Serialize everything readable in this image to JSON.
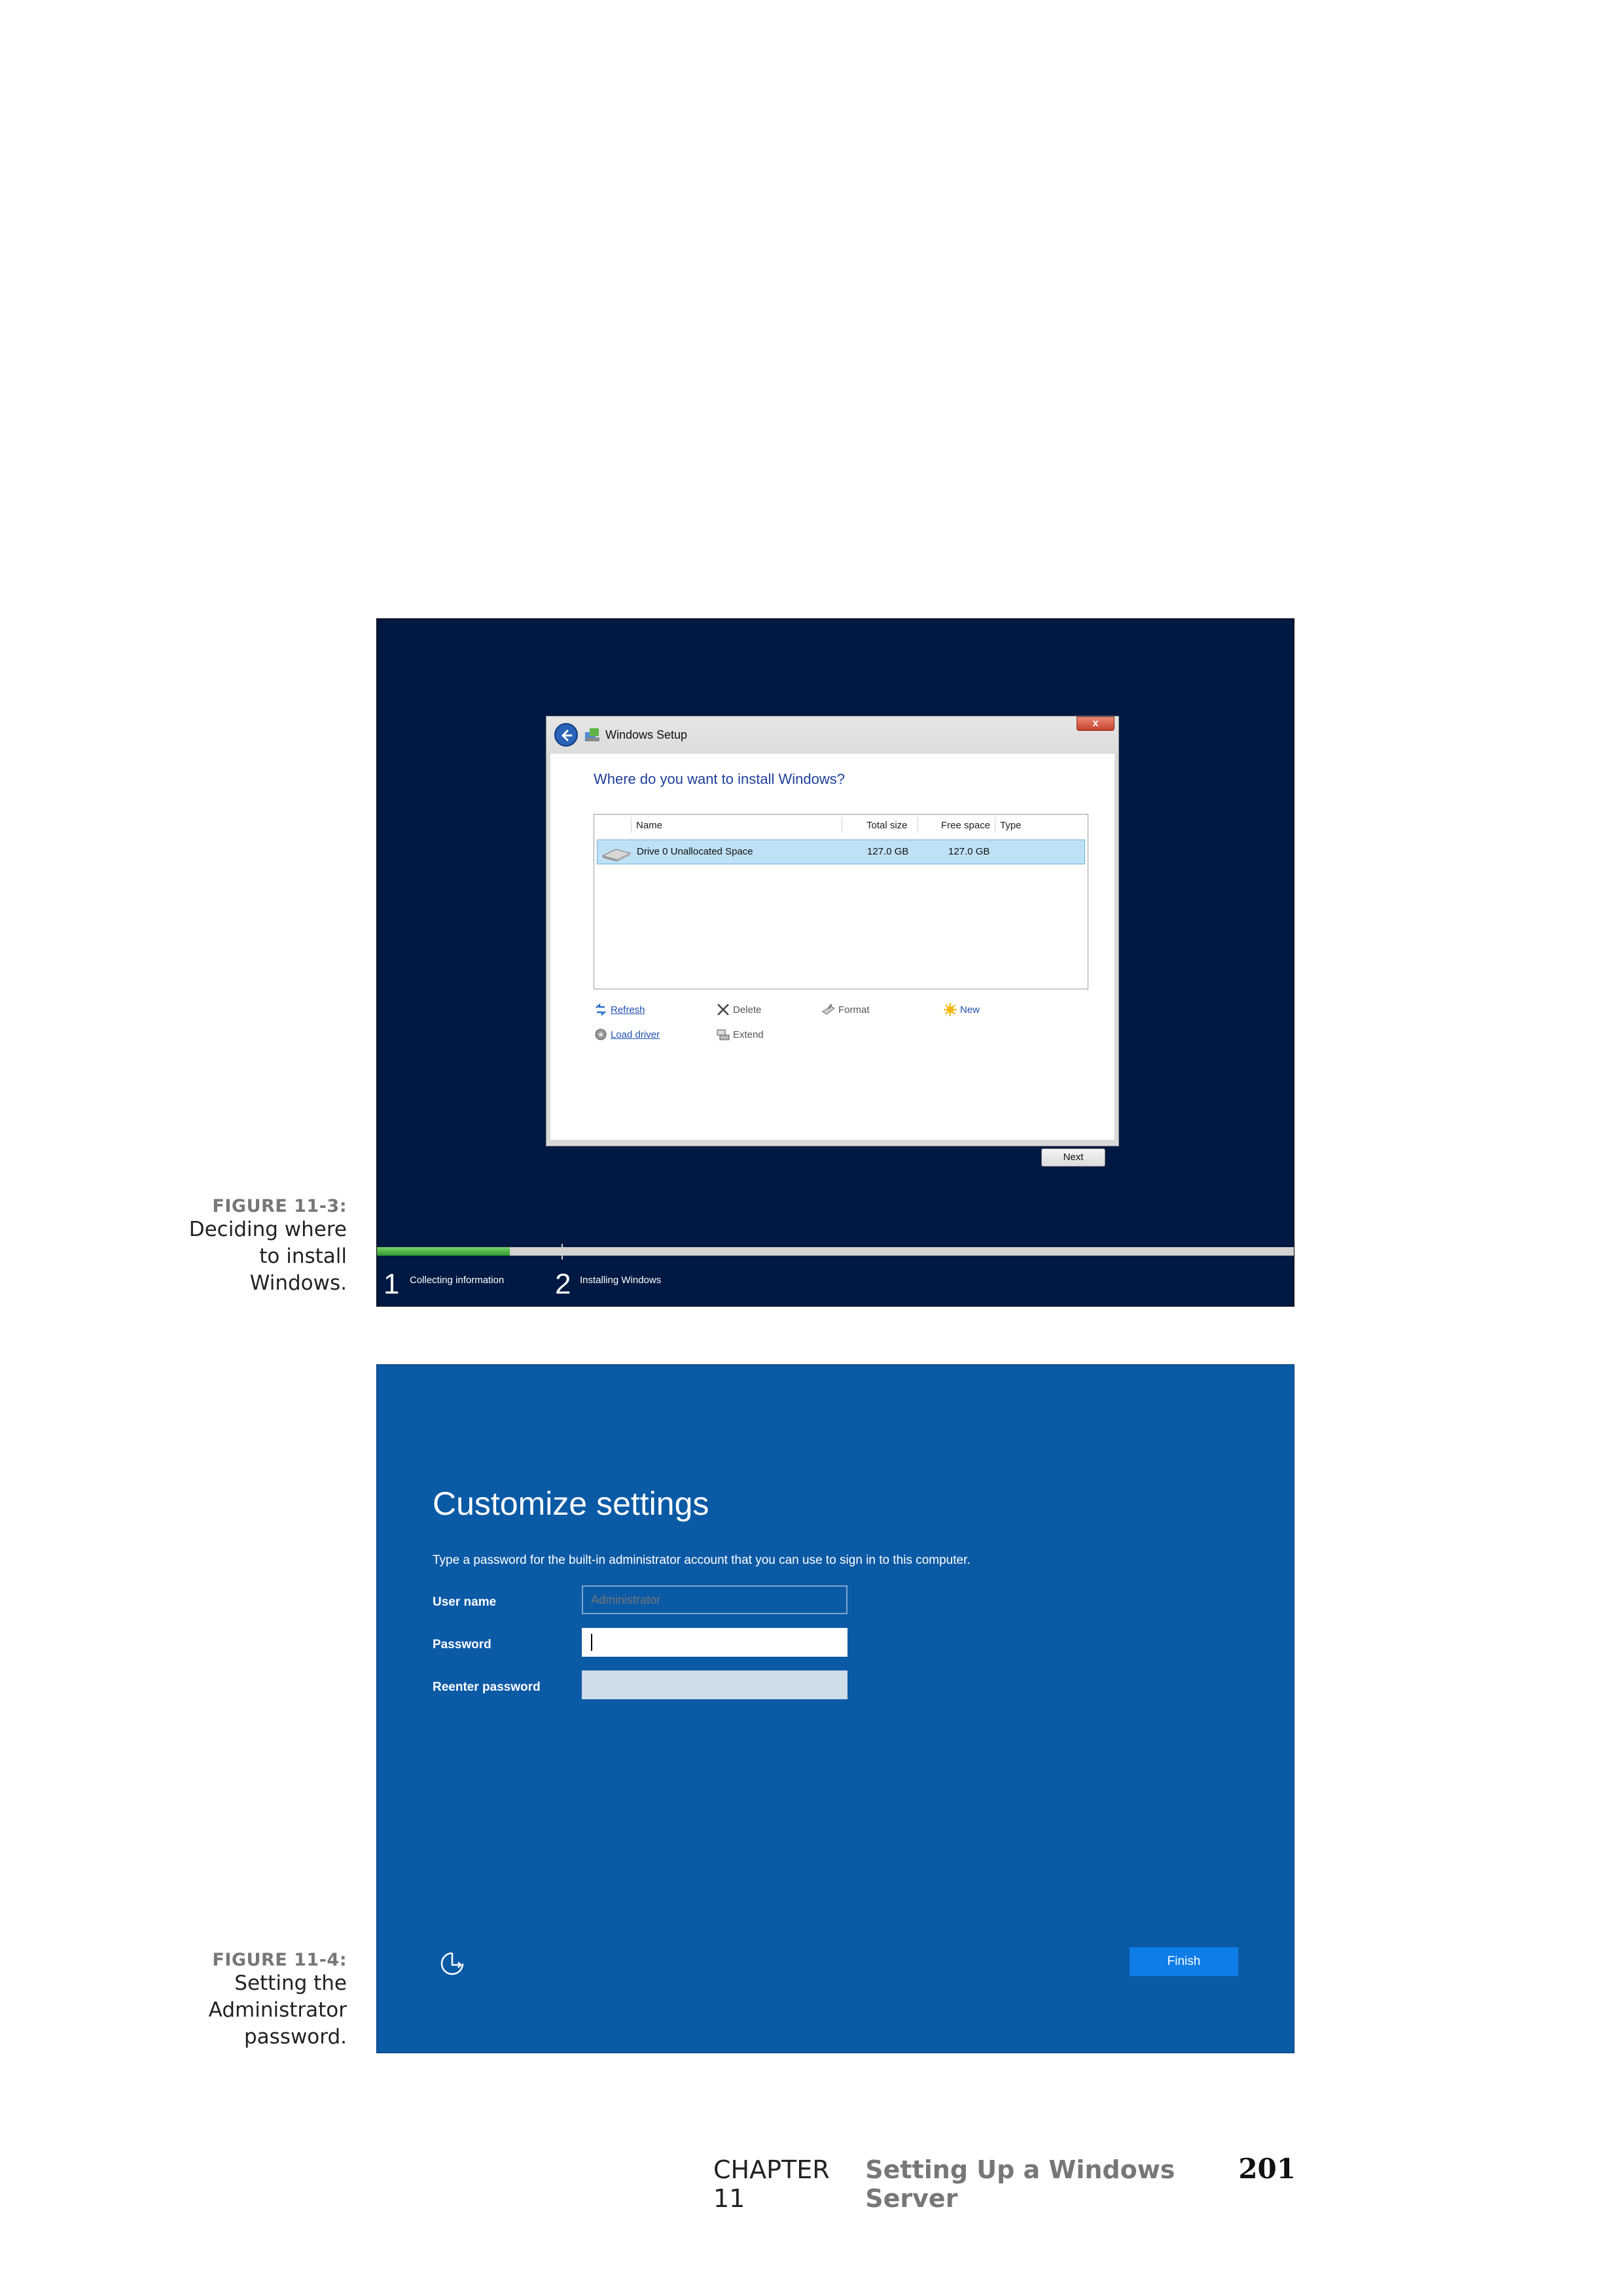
{
  "figure1": {
    "caption": {
      "label": "FIGURE 11-3:",
      "lines": [
        "Deciding where",
        "to install",
        "Windows."
      ]
    },
    "window": {
      "title": "Windows Setup",
      "close_label": "x",
      "question": "Where do you want to install Windows?",
      "table": {
        "headers": {
          "name": "Name",
          "total": "Total size",
          "free": "Free space",
          "type": "Type"
        },
        "rows": [
          {
            "name": "Drive 0 Unallocated Space",
            "total": "127.0 GB",
            "free": "127.0 GB",
            "type": ""
          }
        ]
      },
      "tools": {
        "refresh": "Refresh",
        "delete": "Delete",
        "format": "Format",
        "new": "New",
        "load_driver": "Load driver",
        "extend": "Extend"
      },
      "next_label": "Next"
    },
    "progress": {
      "fraction": 0.145,
      "steps": [
        {
          "num": "1",
          "label": "Collecting information"
        },
        {
          "num": "2",
          "label": "Installing Windows"
        }
      ]
    }
  },
  "figure2": {
    "caption": {
      "label": "FIGURE 11-4:",
      "lines": [
        "Setting the",
        "Administrator",
        "password."
      ]
    },
    "title": "Customize settings",
    "description": "Type a password for the built-in administrator account that you can use to sign in to this computer.",
    "fields": {
      "user_label": "User name",
      "user_placeholder": "Administrator",
      "password_label": "Password",
      "reenter_label": "Reenter password"
    },
    "finish_label": "Finish",
    "icons": {
      "accessibility": "ease-of-access-icon"
    }
  },
  "footer": {
    "chapter": "CHAPTER 11",
    "chapter_title": "Setting Up a Windows Server",
    "page_number": "201"
  }
}
